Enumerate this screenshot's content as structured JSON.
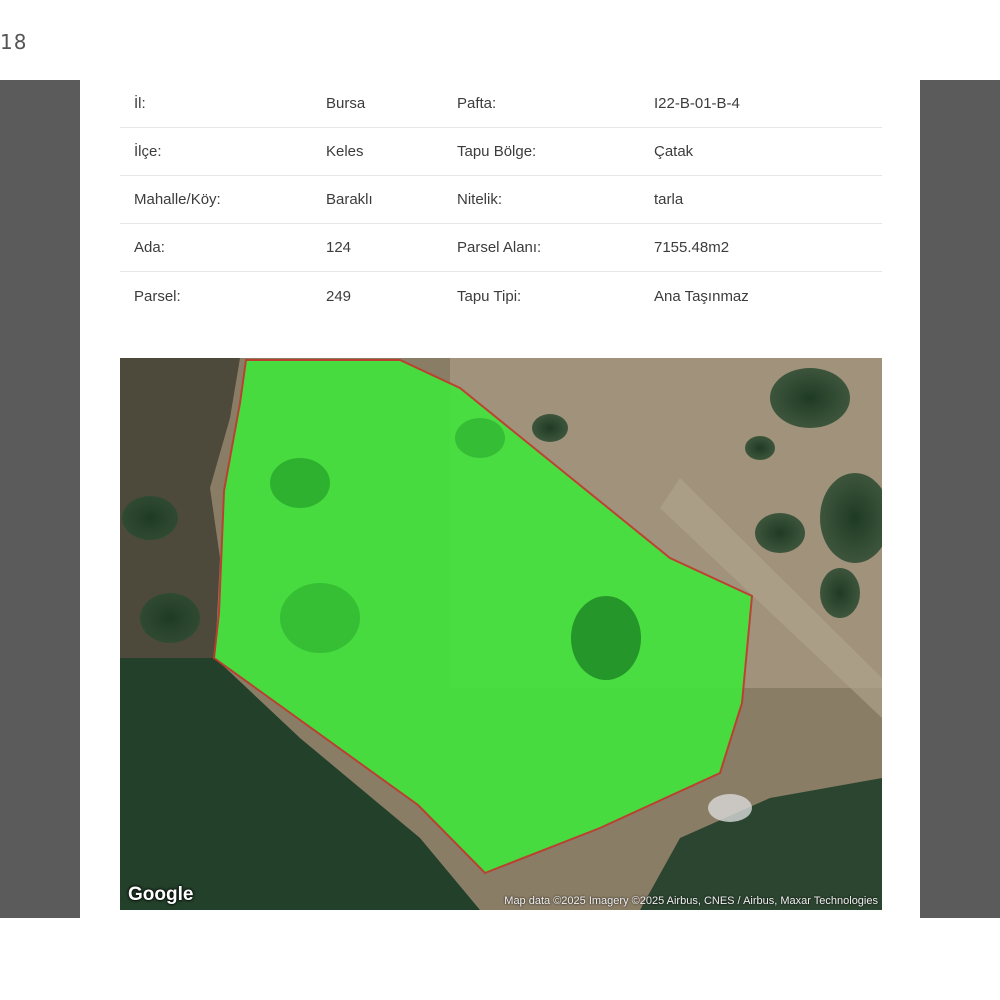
{
  "page_counter": "18",
  "parcel_info": [
    {
      "label1": "İl:",
      "value1": "Bursa",
      "label2": "Pafta:",
      "value2": "I22-B-01-B-4"
    },
    {
      "label1": "İlçe:",
      "value1": "Keles",
      "label2": "Tapu Bölge:",
      "value2": "Çatak"
    },
    {
      "label1": "Mahalle/Köy:",
      "value1": "Baraklı",
      "label2": "Nitelik:",
      "value2": "tarla"
    },
    {
      "label1": "Ada:",
      "value1": "124",
      "label2": "Parsel Alanı:",
      "value2": "7155.48m2"
    },
    {
      "label1": "Parsel:",
      "value1": "249",
      "label2": "Tapu Tipi:",
      "value2": "Ana Taşınmaz"
    }
  ],
  "map": {
    "logo": "Google",
    "attribution": "Map data ©2025 Imagery ©2025 Airbus, CNES / Airbus, Maxar Technologies",
    "parcel_fill_color": "#3ee83a",
    "parcel_border_color": "#c0392b"
  }
}
